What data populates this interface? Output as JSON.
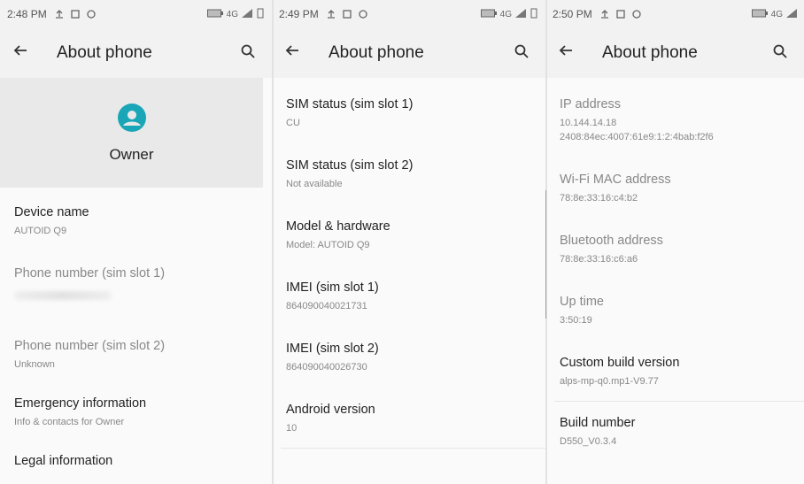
{
  "panels": [
    {
      "status": {
        "time": "2:48 PM",
        "network": "4G"
      },
      "appbar": {
        "title": "About phone"
      },
      "owner": {
        "name": "Owner"
      },
      "items": [
        {
          "title": "Device name",
          "subtitle": "AUTOID Q9"
        },
        {
          "title": "Phone number (sim slot 1)",
          "subtitle": ""
        },
        {
          "title": "Phone number (sim slot 2)",
          "subtitle": "Unknown"
        },
        {
          "title": "Emergency information",
          "subtitle": "Info & contacts for Owner"
        },
        {
          "title": "Legal information",
          "subtitle": ""
        }
      ]
    },
    {
      "status": {
        "time": "2:49 PM",
        "network": "4G"
      },
      "appbar": {
        "title": "About phone"
      },
      "items": [
        {
          "title": "SIM status (sim slot 1)",
          "subtitle": "CU"
        },
        {
          "title": "SIM status (sim slot 2)",
          "subtitle": "Not available"
        },
        {
          "title": "Model & hardware",
          "subtitle": "Model: AUTOID Q9"
        },
        {
          "title": "IMEI (sim slot 1)",
          "subtitle": "864090040021731"
        },
        {
          "title": "IMEI (sim slot 2)",
          "subtitle": "864090040026730"
        },
        {
          "title": "Android version",
          "subtitle": "10"
        }
      ]
    },
    {
      "status": {
        "time": "2:50 PM",
        "network": "4G"
      },
      "appbar": {
        "title": "About phone"
      },
      "items": [
        {
          "title": "IP address",
          "subtitle": "10.144.14.18",
          "subtitle2": "2408:84ec:4007:61e9:1:2:4bab:f2f6"
        },
        {
          "title": "Wi-Fi MAC address",
          "subtitle": "78:8e:33:16:c4:b2"
        },
        {
          "title": "Bluetooth address",
          "subtitle": "78:8e:33:16:c6:a6"
        },
        {
          "title": "Up time",
          "subtitle": "3:50:19"
        },
        {
          "title": "Custom build version",
          "subtitle": "alps-mp-q0.mp1-V9.77"
        },
        {
          "title": "Build number",
          "subtitle": "D550_V0.3.4"
        }
      ]
    }
  ],
  "icons": {
    "back": "back-arrow-icon",
    "search": "search-icon",
    "avatar": "account-circle-icon"
  },
  "colors": {
    "accent": "#1aa6b7"
  }
}
